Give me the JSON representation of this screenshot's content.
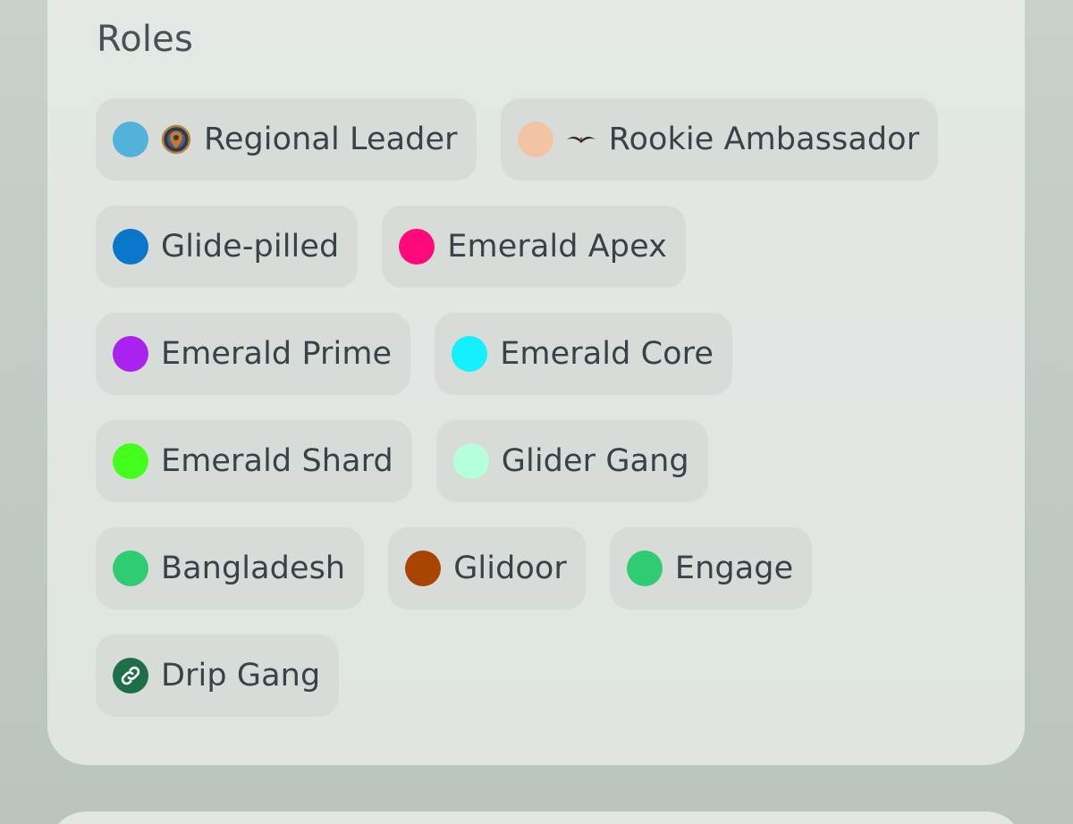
{
  "section": {
    "title": "Roles"
  },
  "roles": [
    {
      "label": "Regional Leader",
      "color": "#52b2d9",
      "icon": "badge-emblem-icon"
    },
    {
      "label": "Rookie Ambassador",
      "color": "#f2c4a3",
      "icon": "bird-wings-icon"
    },
    {
      "label": "Glide-pilled",
      "color": "#0a76c9"
    },
    {
      "label": "Emerald Apex",
      "color": "#ff0a7a"
    },
    {
      "label": "Emerald Prime",
      "color": "#aa22f0"
    },
    {
      "label": "Emerald Core",
      "color": "#14f0ff"
    },
    {
      "label": "Emerald Shard",
      "color": "#44ff1e"
    },
    {
      "label": "Glider Gang",
      "color": "#b5ffdc"
    },
    {
      "label": "Bangladesh",
      "color": "#2fcc74"
    },
    {
      "label": "Glidoor",
      "color": "#a84300"
    },
    {
      "label": "Engage",
      "color": "#2fcc74"
    },
    {
      "label": "Drip Gang",
      "color": "#1e6e4a",
      "icon": "link-icon"
    }
  ]
}
